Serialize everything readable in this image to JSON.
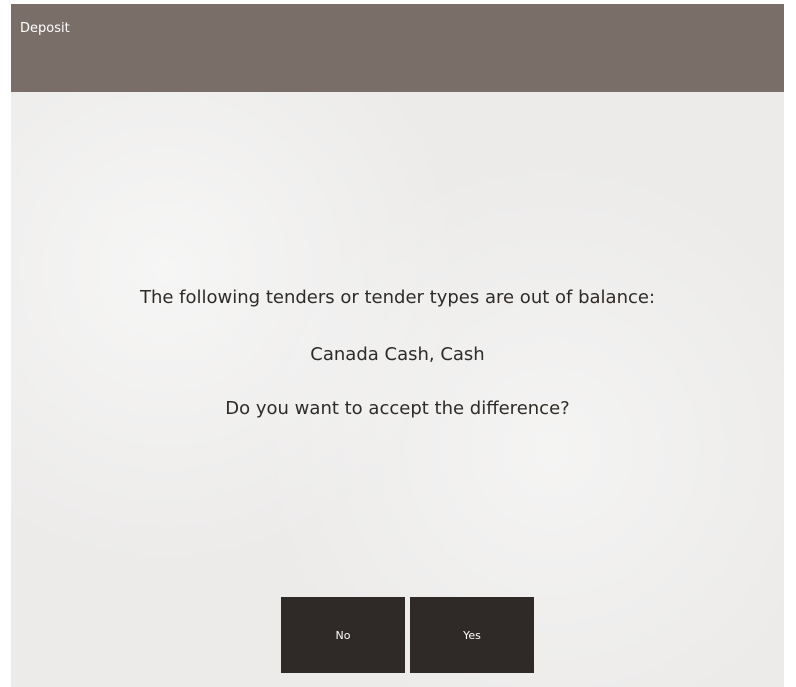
{
  "window": {
    "title": "Deposit"
  },
  "message": {
    "line1": "The following tenders or tender types are out of balance:",
    "line2": "Canada Cash, Cash",
    "line3": "Do you want to accept the difference?"
  },
  "buttons": {
    "no_label": "No",
    "yes_label": "Yes"
  },
  "colors": {
    "titlebar": "#7a6f68",
    "content_bg": "#ecebea",
    "button_bg": "#2f2a27",
    "button_text": "#ffffff",
    "message_text": "#2e2a27"
  }
}
